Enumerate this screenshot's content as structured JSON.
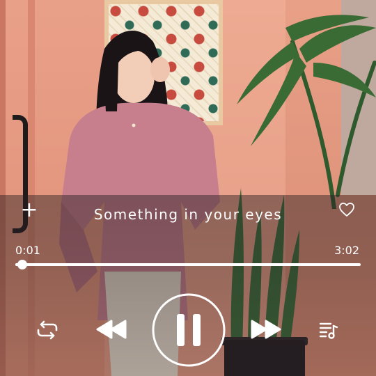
{
  "player": {
    "track_title": "Something in your eyes",
    "current_time": "0:01",
    "total_time": "3:02",
    "progress_fraction": 0.006,
    "state": "playing"
  },
  "icons": {
    "add": "+",
    "favorite": "heart-outline-icon",
    "repeat": "repeat-icon",
    "previous": "rewind-icon",
    "pause": "pause-icon",
    "next": "fast-forward-icon",
    "queue": "playlist-icon"
  },
  "colors": {
    "foreground": "#ffffff",
    "overlay": "#281c1e"
  }
}
